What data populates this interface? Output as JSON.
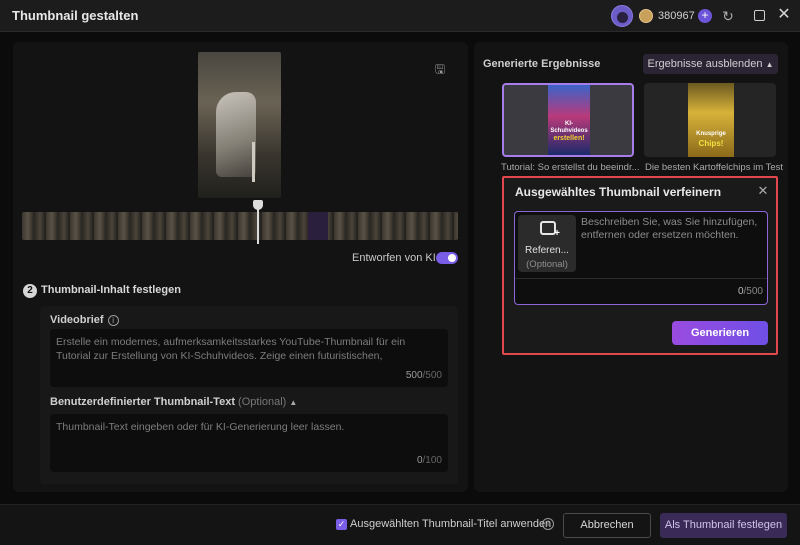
{
  "window": {
    "title": "Thumbnail gestalten",
    "credits": "380967",
    "plus_label": "+"
  },
  "preview": {
    "ai_designed_label": "Entworfen von KI"
  },
  "content_section": {
    "step_number": "2",
    "title": "Thumbnail-Inhalt festlegen",
    "videobrief": {
      "label": "Videobrief",
      "value": "Erstelle ein modernes, aufmerksamkeitsstarkes YouTube-Thumbnail für ein Tutorial zur Erstellung von KI-Schuhvideos. Zeige einen futuristischen, hochwertigen Sneaker im",
      "count": "500",
      "max": "/500"
    },
    "custom_text": {
      "label": "Benutzerdefinierter Thumbnail-Text",
      "optional": "(Optional)",
      "placeholder": "Thumbnail-Text eingeben oder für KI-Generierung leer lassen.",
      "count": "0",
      "max": "/100"
    }
  },
  "results": {
    "label": "Generierte Ergebnisse",
    "hide_button": "Ergebnisse ausblenden",
    "items": [
      {
        "caption": "Tutorial: So erstellst du beeindr...",
        "art_line1": "KI-Schuhvideos",
        "art_line2": "erstellen!"
      },
      {
        "caption": "Die besten Kartoffelchips im Test",
        "art_line1": "Knusprige",
        "art_line2": "Chips!"
      }
    ]
  },
  "refine_dialog": {
    "title": "Ausgewähltes Thumbnail verfeinern",
    "reference_label": "Referen...",
    "reference_optional": "(Optional)",
    "placeholder": "Beschreiben Sie, was Sie hinzufügen, entfernen oder ersetzen möchten.",
    "count": "0",
    "max": "/500",
    "generate_button": "Generieren"
  },
  "footer": {
    "apply_title_label": "Ausgewählten Thumbnail-Titel anwenden",
    "apply_title_checked": true,
    "cancel_button": "Abbrechen",
    "confirm_button": "Als Thumbnail festlegen"
  },
  "icons": {
    "avatar": "avatar-icon",
    "coin": "coin-icon",
    "refresh": "refresh-icon",
    "restore": "restore-window-icon",
    "close": "close-icon",
    "save": "save-icon",
    "info": "info-icon",
    "chevron_up": "chevron-up-icon",
    "add_image": "add-image-icon"
  },
  "colors": {
    "accent": "#7a5de6",
    "highlight_border": "#e2474e",
    "generate_gradient_start": "#9a4be0",
    "generate_gradient_end": "#6f4fe6"
  }
}
